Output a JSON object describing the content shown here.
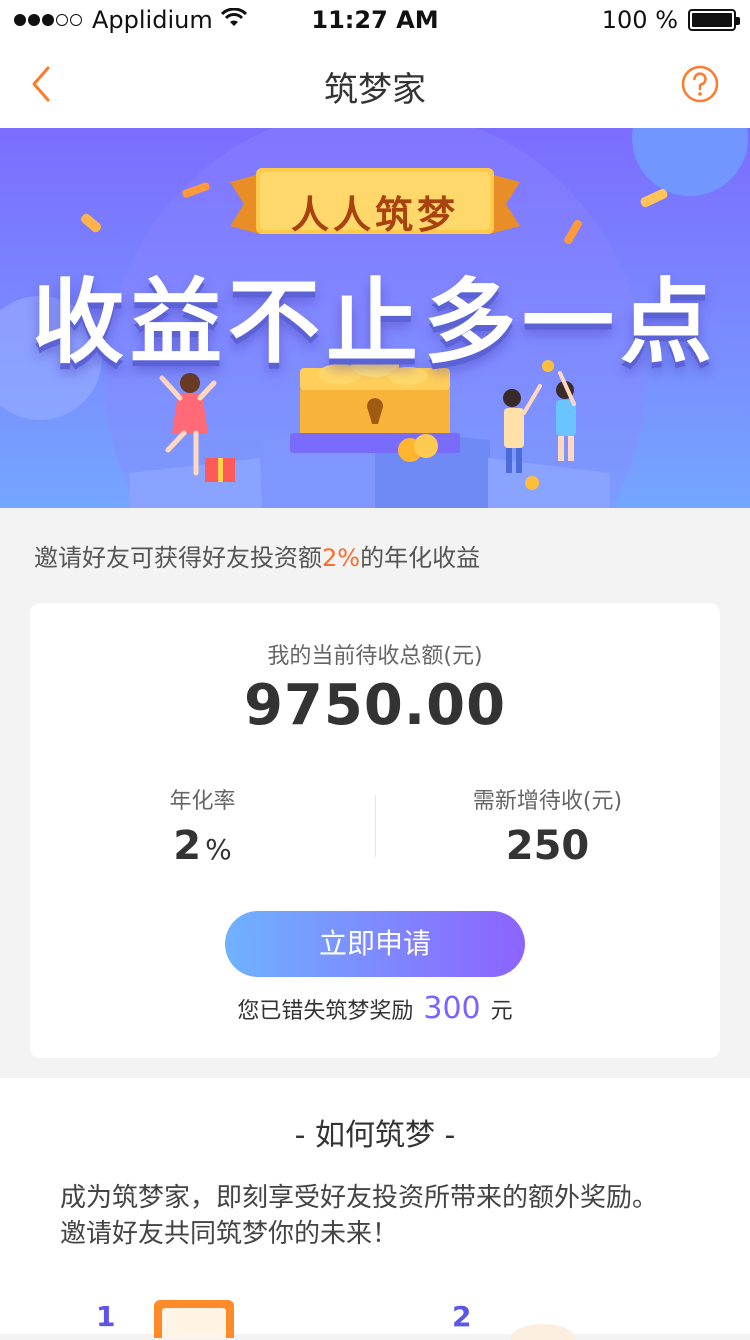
{
  "status_bar": {
    "carrier": "Applidium",
    "time": "11:27 AM",
    "battery": "100 %"
  },
  "nav": {
    "title": "筑梦家",
    "back_icon": "chevron-left-icon",
    "help_icon": "question-circle-icon"
  },
  "banner": {
    "ribbon": "人人筑梦",
    "headline": "收益不止多一点"
  },
  "invite": {
    "prefix": "邀请好友可获得好友投资额",
    "percent": "2%",
    "suffix": "的年化收益"
  },
  "card": {
    "pending_label": "我的当前待收总额(元)",
    "pending_value": "9750.00",
    "rate_label": "年化率",
    "rate_value": "2",
    "rate_unit": "%",
    "need_label": "需新增待收(元)",
    "need_value": "250",
    "apply_button": "立即申请",
    "missed_prefix": "您已错失筑梦奖励",
    "missed_amount": "300",
    "missed_unit": "元"
  },
  "howto": {
    "heading": "- 如何筑梦 -",
    "line1": "成为筑梦家，即刻享受好友投资所带来的额外奖励。",
    "line2": "邀请好友共同筑梦你的未来！",
    "step1": "1",
    "step2": "2"
  },
  "colors": {
    "accent_orange": "#ff6b2c",
    "accent_purple": "#7a63ff",
    "button_gradient_start": "#6fb2ff",
    "button_gradient_end": "#8c63ff"
  }
}
